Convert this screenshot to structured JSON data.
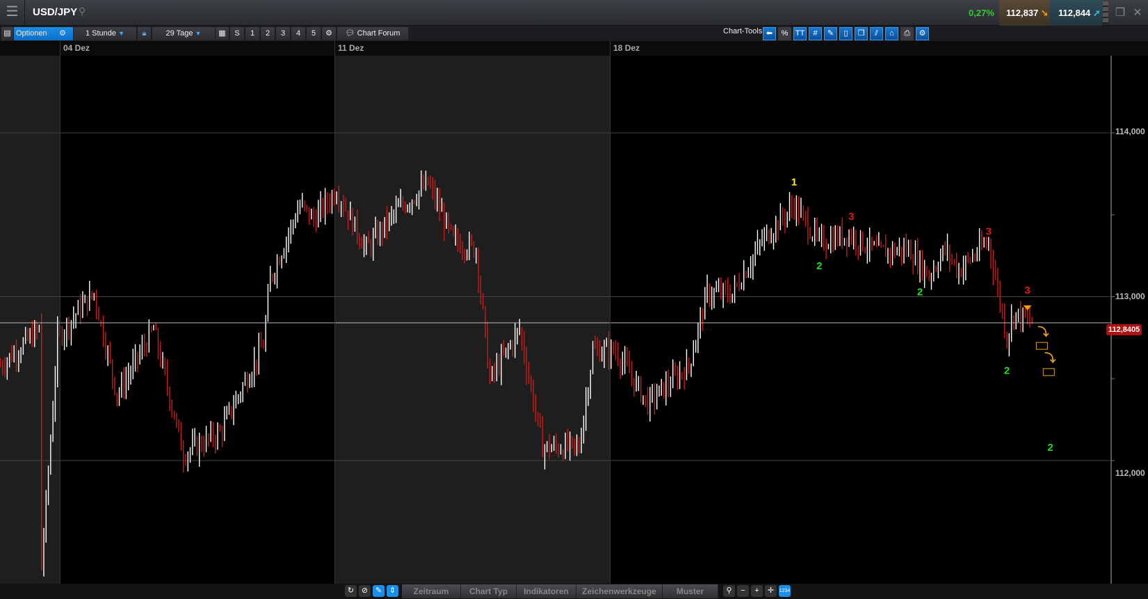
{
  "header": {
    "menu_icon": "hamburger-icon",
    "symbol": "USD/JPY",
    "change": "0,27%",
    "bid": "112,837",
    "ask": "112,844"
  },
  "toolbar": {
    "options": "Optionen",
    "interval": "1 Stunde",
    "range": "29 Tage",
    "quick": [
      "S",
      "1",
      "2",
      "3",
      "4",
      "5"
    ],
    "forum": "Chart Forum",
    "chart_tools": "Chart-Tools",
    "percent": "%",
    "text_tool": "TT"
  },
  "dates": [
    "04 Dez",
    "11 Dez",
    "18 Dez"
  ],
  "axis": {
    "labels": [
      "114,000",
      "113,000",
      "112,000"
    ],
    "current_price": "112,8405"
  },
  "bottom": {
    "tabs": [
      "Zeitraum",
      "Chart Typ",
      "Indikatoren",
      "Zeichenwerkzeuge",
      "Muster"
    ]
  },
  "colors": {
    "up": "#ffffff",
    "down": "#d01818",
    "accent": "#1b8ee8",
    "current": "#b01010"
  },
  "chart_data": {
    "type": "ohlc",
    "ylim": [
      111.2,
      114.6
    ],
    "x_unit": "hours since 04 Dez 00:00",
    "key_prices": [
      [
        -26,
        112.58
      ],
      [
        -9,
        112.8
      ],
      [
        -8,
        111.35
      ],
      [
        -4,
        112.13
      ],
      [
        -1,
        112.75
      ],
      [
        9,
        112.93
      ],
      [
        15,
        113.02
      ],
      [
        25,
        112.4
      ],
      [
        41,
        112.8
      ],
      [
        54,
        112.04
      ],
      [
        70,
        112.17
      ],
      [
        89,
        112.71
      ],
      [
        92,
        113.11
      ],
      [
        105,
        113.56
      ],
      [
        111,
        113.47
      ],
      [
        121,
        113.65
      ],
      [
        134,
        113.29
      ],
      [
        147,
        113.52
      ],
      [
        161,
        113.69
      ],
      [
        172,
        113.34
      ],
      [
        182,
        113.29
      ],
      [
        188,
        112.49
      ],
      [
        201,
        112.8
      ],
      [
        211,
        112.08
      ],
      [
        227,
        112.08
      ],
      [
        233,
        112.67
      ],
      [
        243,
        112.67
      ],
      [
        257,
        112.35
      ],
      [
        275,
        112.58
      ],
      [
        283,
        113.02
      ],
      [
        294,
        113.02
      ],
      [
        307,
        113.34
      ],
      [
        321,
        113.56
      ],
      [
        332,
        113.33
      ],
      [
        345,
        113.38
      ],
      [
        358,
        113.27
      ],
      [
        371,
        113.29
      ],
      [
        380,
        113.13
      ],
      [
        387,
        113.29
      ],
      [
        393,
        113.16
      ],
      [
        406,
        113.34
      ],
      [
        414,
        112.75
      ],
      [
        417,
        112.9
      ],
      [
        425,
        112.84
      ]
    ],
    "wave_labels": [
      {
        "text": "1",
        "h": 321,
        "p": 113.7,
        "color": "#ffee00"
      },
      {
        "text": "3",
        "h": 346,
        "p": 113.49,
        "color": "#e01818"
      },
      {
        "text": "3",
        "h": 406,
        "p": 113.4,
        "color": "#e01818"
      },
      {
        "text": "3",
        "h": 423,
        "p": 113.04,
        "color": "#e01818"
      },
      {
        "text": "2",
        "h": 332,
        "p": 113.19,
        "color": "#22dd22"
      },
      {
        "text": "2",
        "h": 376,
        "p": 113.03,
        "color": "#22dd22"
      },
      {
        "text": "2",
        "h": 414,
        "p": 112.55,
        "color": "#22dd22"
      },
      {
        "text": "2",
        "h": 433,
        "p": 112.08,
        "color": "#22dd22"
      }
    ],
    "current_price": 112.8405
  }
}
